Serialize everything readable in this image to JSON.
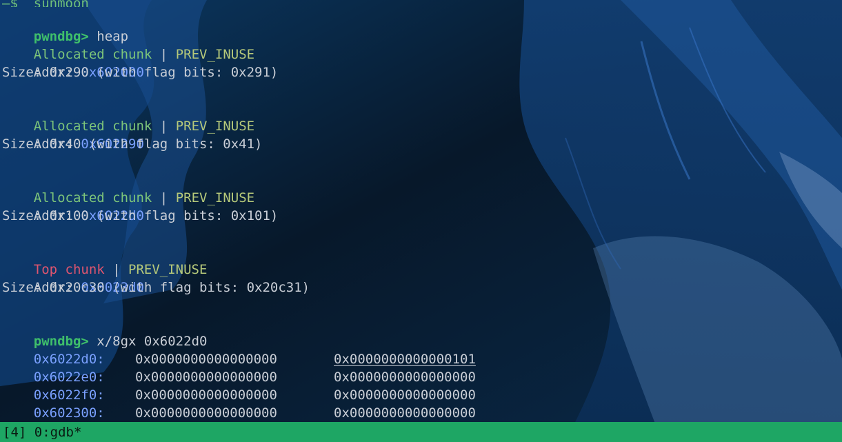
{
  "status_bar": {
    "text": "[4] 0:gdb*"
  },
  "top_fragment": "—$  sunmoon",
  "prompt": "pwndbg>",
  "commands": {
    "heap": "heap",
    "examine": "x/8gx 0x6022d0"
  },
  "chunks": [
    {
      "title": "Allocated chunk",
      "sep": " | ",
      "flag": "PREV_INUSE",
      "addr_label": "Addr: ",
      "addr": "0x602000",
      "size_text": "Size: 0x290 (with flag bits: 0x291)"
    },
    {
      "title": "Allocated chunk",
      "sep": " | ",
      "flag": "PREV_INUSE",
      "addr_label": "Addr: ",
      "addr": "0x602290",
      "size_text": "Size: 0x40 (with flag bits: 0x41)"
    },
    {
      "title": "Allocated chunk",
      "sep": " | ",
      "flag": "PREV_INUSE",
      "addr_label": "Addr: ",
      "addr": "0x6022d0",
      "size_text": "Size: 0x100 (with flag bits: 0x101)"
    },
    {
      "title": "Top chunk",
      "sep": " | ",
      "flag": "PREV_INUSE",
      "addr_label": "Addr: ",
      "addr": "0x6023d0",
      "size_text": "Size: 0x20c30 (with flag bits: 0x20c31)"
    }
  ],
  "memory_rows": [
    {
      "addr": "0x6022d0:",
      "v1": "0x0000000000000000",
      "v2": "0x0000000000000101"
    },
    {
      "addr": "0x6022e0:",
      "v1": "0x0000000000000000",
      "v2": "0x0000000000000000"
    },
    {
      "addr": "0x6022f0:",
      "v1": "0x0000000000000000",
      "v2": "0x0000000000000000"
    },
    {
      "addr": "0x602300:",
      "v1": "0x0000000000000000",
      "v2": "0x0000000000000000"
    }
  ],
  "colors": {
    "prompt": "#3fbf6b",
    "allocated": "#7dc57a",
    "top_chunk": "#e0556f",
    "flag": "#b6c97a",
    "address": "#7aa0ff",
    "status_bar": "#1ea664"
  }
}
